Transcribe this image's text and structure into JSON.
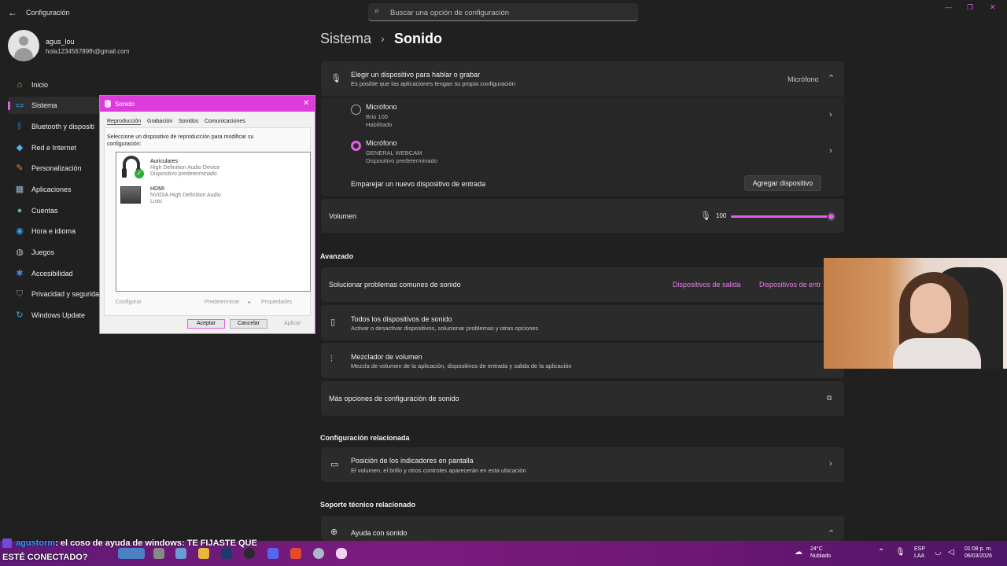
{
  "app": {
    "title": "Configuración",
    "search_placeholder": "Buscar una opción de configuración"
  },
  "user": {
    "name": "agus_lou",
    "email": "hola123456789fh@gmail.com"
  },
  "sidebar": {
    "items": [
      {
        "label": "Inicio",
        "icon": "home-icon",
        "active": false
      },
      {
        "label": "Sistema",
        "icon": "monitor-icon",
        "active": true
      },
      {
        "label": "Bluetooth y dispositi",
        "icon": "bluetooth-icon",
        "active": false
      },
      {
        "label": "Red e Internet",
        "icon": "wifi-icon",
        "active": false
      },
      {
        "label": "Personalización",
        "icon": "brush-icon",
        "active": false
      },
      {
        "label": "Aplicaciones",
        "icon": "apps-icon",
        "active": false
      },
      {
        "label": "Cuentas",
        "icon": "person-icon",
        "active": false
      },
      {
        "label": "Hora e idioma",
        "icon": "globe-clock-icon",
        "active": false
      },
      {
        "label": "Juegos",
        "icon": "gamepad-icon",
        "active": false
      },
      {
        "label": "Accesibilidad",
        "icon": "accessibility-icon",
        "active": false
      },
      {
        "label": "Privacidad y segurida",
        "icon": "shield-icon",
        "active": false
      },
      {
        "label": "Windows Update",
        "icon": "update-icon",
        "active": false
      }
    ]
  },
  "breadcrumb": {
    "parent": "Sistema",
    "separator": "›",
    "current": "Sonido"
  },
  "input_section": {
    "title": "Elegir un dispositivo para hablar o grabar",
    "subtitle": "Es posible que las aplicaciones tengan su propia configuración",
    "value": "Micrófono",
    "devices": [
      {
        "name": "Micrófono",
        "model": "Brio 100",
        "status": "Habilitado",
        "selected": false
      },
      {
        "name": "Micrófono",
        "model": "GENERAL WEBCAM",
        "status": "Dispositivo predeterminado",
        "selected": true
      }
    ],
    "pair_label": "Emparejar un nuevo dispositivo de entrada",
    "add_button": "Agregar dispositivo"
  },
  "volume": {
    "label": "Volumen",
    "value": "100",
    "level": 1.0
  },
  "advanced": {
    "heading": "Avanzado",
    "troubleshoot": "Solucionar problemas comunes de sonido",
    "link_output": "Dispositivos de salida",
    "link_input": "Dispositivos de entr",
    "all_devices_title": "Todos los dispositivos de sonido",
    "all_devices_sub": "Activar o desactivar dispositivos, solucionar problemas y otras opciones",
    "mixer_title": "Mezclador de volumen",
    "mixer_sub": "Mezcla de volumen de la aplicación, dispositivos de entrada y salida de la aplicación",
    "more_options": "Más opciones de configuración de sonido"
  },
  "related": {
    "heading": "Configuración relacionada",
    "indicators_title": "Posición de los indicadores en pantalla",
    "indicators_sub": "El volumen, el brillo y otros controles aparecerán en esta ubicación"
  },
  "support": {
    "heading": "Soporte técnico relacionado",
    "help_title": "Ayuda con sonido"
  },
  "sound_dialog": {
    "title": "Sonido",
    "tabs": [
      "Reproducción",
      "Grabación",
      "Sonidos",
      "Comunicaciones"
    ],
    "description": "Seleccione un dispositivo de reproducción para modificar su configuración:",
    "devices": [
      {
        "name": "Auriculares",
        "desc": "High Definition Audio Device",
        "status": "Dispositivo predeterminado",
        "icon": "headphones-icon"
      },
      {
        "name": "HDMI",
        "desc": "NVIDIA High Definition Audio",
        "status": "Listo",
        "icon": "display-icon"
      }
    ],
    "configure": "Configurar",
    "set_default": "Predeterminar",
    "properties": "Propiedades",
    "ok": "Aceptar",
    "cancel": "Cancelar",
    "apply": "Aplicar"
  },
  "chat": {
    "user": "agustorm",
    "message_line1": ": el coso de ayuda de windows: TE FIJASTE QUE",
    "message_line2": "ESTÉ CONECTADO?"
  },
  "taskbar": {
    "weather_temp": "24°C",
    "weather_desc": "Nublado",
    "lang": "ESP",
    "lang_sub": "LAA",
    "time": "01:08 p. m.",
    "date": "06/03/2026"
  },
  "colors": {
    "accent": "#e05fe5",
    "background": "#202020",
    "card": "#2b2b2b",
    "taskbar": "#6c1773"
  }
}
